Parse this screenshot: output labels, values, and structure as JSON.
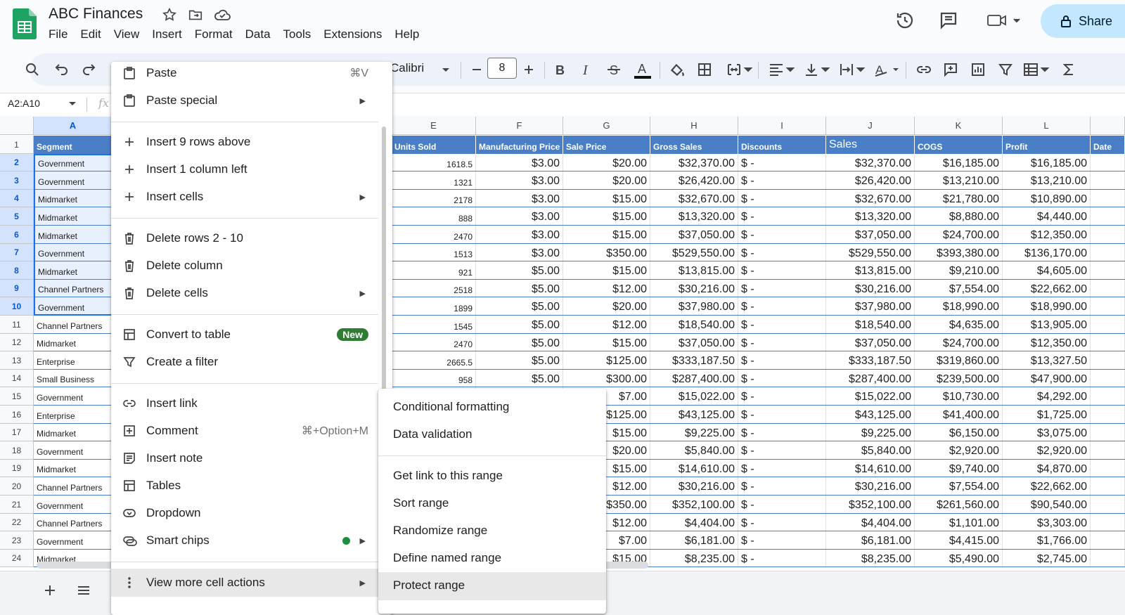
{
  "app": {
    "title": "ABC Finances",
    "share_label": "Share",
    "menu": [
      "File",
      "Edit",
      "View",
      "Insert",
      "Format",
      "Data",
      "Tools",
      "Extensions",
      "Help"
    ]
  },
  "toolbar": {
    "font": "Calibri",
    "font_size": "8"
  },
  "formula_bar": {
    "name_box": "A2:A10",
    "fx": "fx"
  },
  "grid": {
    "col_headers": [
      "A",
      "E",
      "F",
      "G",
      "H",
      "I",
      "J",
      "K",
      "L"
    ],
    "header_row": [
      "Segment",
      "Units Sold",
      "Manufacturing Price",
      "Sale Price",
      "Gross Sales",
      "Discounts",
      "Sales",
      "COGS",
      "Profit",
      "Date"
    ],
    "rows": [
      {
        "n": "1"
      },
      {
        "n": "2",
        "seg": "Government",
        "units": "1618.5",
        "mfg": "$3.00",
        "sale": "$20.00",
        "gross": "$32,370.00",
        "disc": "$ -",
        "sales": "$32,370.00",
        "cogs": "$16,185.00",
        "profit": "$16,185.00"
      },
      {
        "n": "3",
        "seg": "Government",
        "units": "1321",
        "mfg": "$3.00",
        "sale": "$20.00",
        "gross": "$26,420.00",
        "disc": "$ -",
        "sales": "$26,420.00",
        "cogs": "$13,210.00",
        "profit": "$13,210.00"
      },
      {
        "n": "4",
        "seg": "Midmarket",
        "units": "2178",
        "mfg": "$3.00",
        "sale": "$15.00",
        "gross": "$32,670.00",
        "disc": "$ -",
        "sales": "$32,670.00",
        "cogs": "$21,780.00",
        "profit": "$10,890.00"
      },
      {
        "n": "5",
        "seg": "Midmarket",
        "units": "888",
        "mfg": "$3.00",
        "sale": "$15.00",
        "gross": "$13,320.00",
        "disc": "$ -",
        "sales": "$13,320.00",
        "cogs": "$8,880.00",
        "profit": "$4,440.00"
      },
      {
        "n": "6",
        "seg": "Midmarket",
        "units": "2470",
        "mfg": "$3.00",
        "sale": "$15.00",
        "gross": "$37,050.00",
        "disc": "$ -",
        "sales": "$37,050.00",
        "cogs": "$24,700.00",
        "profit": "$12,350.00"
      },
      {
        "n": "7",
        "seg": "Government",
        "units": "1513",
        "mfg": "$3.00",
        "sale": "$350.00",
        "gross": "$529,550.00",
        "disc": "$ -",
        "sales": "$529,550.00",
        "cogs": "$393,380.00",
        "profit": "$136,170.00"
      },
      {
        "n": "8",
        "seg": "Midmarket",
        "units": "921",
        "mfg": "$5.00",
        "sale": "$15.00",
        "gross": "$13,815.00",
        "disc": "$ -",
        "sales": "$13,815.00",
        "cogs": "$9,210.00",
        "profit": "$4,605.00"
      },
      {
        "n": "9",
        "seg": "Channel Partners",
        "units": "2518",
        "mfg": "$5.00",
        "sale": "$12.00",
        "gross": "$30,216.00",
        "disc": "$ -",
        "sales": "$30,216.00",
        "cogs": "$7,554.00",
        "profit": "$22,662.00"
      },
      {
        "n": "10",
        "seg": "Government",
        "units": "1899",
        "mfg": "$5.00",
        "sale": "$20.00",
        "gross": "$37,980.00",
        "disc": "$ -",
        "sales": "$37,980.00",
        "cogs": "$18,990.00",
        "profit": "$18,990.00"
      },
      {
        "n": "11",
        "seg": "Channel Partners",
        "units": "1545",
        "mfg": "$5.00",
        "sale": "$12.00",
        "gross": "$18,540.00",
        "disc": "$ -",
        "sales": "$18,540.00",
        "cogs": "$4,635.00",
        "profit": "$13,905.00"
      },
      {
        "n": "12",
        "seg": "Midmarket",
        "units": "2470",
        "mfg": "$5.00",
        "sale": "$15.00",
        "gross": "$37,050.00",
        "disc": "$ -",
        "sales": "$37,050.00",
        "cogs": "$24,700.00",
        "profit": "$12,350.00"
      },
      {
        "n": "13",
        "seg": "Enterprise",
        "units": "2665.5",
        "mfg": "$5.00",
        "sale": "$125.00",
        "gross": "$333,187.50",
        "disc": "$ -",
        "sales": "$333,187.50",
        "cogs": "$319,860.00",
        "profit": "$13,327.50"
      },
      {
        "n": "14",
        "seg": "Small Business",
        "units": "958",
        "mfg": "$5.00",
        "sale": "$300.00",
        "gross": "$287,400.00",
        "disc": "$ -",
        "sales": "$287,400.00",
        "cogs": "$239,500.00",
        "profit": "$47,900.00"
      },
      {
        "n": "15",
        "seg": "Government",
        "sale": "$7.00",
        "gross": "$15,022.00",
        "disc": "$ -",
        "sales": "$15,022.00",
        "cogs": "$10,730.00",
        "profit": "$4,292.00"
      },
      {
        "n": "16",
        "seg": "Enterprise",
        "sale": "$125.00",
        "gross": "$43,125.00",
        "disc": "$ -",
        "sales": "$43,125.00",
        "cogs": "$41,400.00",
        "profit": "$1,725.00"
      },
      {
        "n": "17",
        "seg": "Midmarket",
        "sale": "$15.00",
        "gross": "$9,225.00",
        "disc": "$ -",
        "sales": "$9,225.00",
        "cogs": "$6,150.00",
        "profit": "$3,075.00"
      },
      {
        "n": "18",
        "seg": "Government",
        "sale": "$20.00",
        "gross": "$5,840.00",
        "disc": "$ -",
        "sales": "$5,840.00",
        "cogs": "$2,920.00",
        "profit": "$2,920.00"
      },
      {
        "n": "19",
        "seg": "Midmarket",
        "sale": "$15.00",
        "gross": "$14,610.00",
        "disc": "$ -",
        "sales": "$14,610.00",
        "cogs": "$9,740.00",
        "profit": "$4,870.00"
      },
      {
        "n": "20",
        "seg": "Channel Partners",
        "sale": "$12.00",
        "gross": "$30,216.00",
        "disc": "$ -",
        "sales": "$30,216.00",
        "cogs": "$7,554.00",
        "profit": "$22,662.00"
      },
      {
        "n": "21",
        "seg": "Government",
        "sale": "$350.00",
        "gross": "$352,100.00",
        "disc": "$ -",
        "sales": "$352,100.00",
        "cogs": "$261,560.00",
        "profit": "$90,540.00"
      },
      {
        "n": "22",
        "seg": "Channel Partners",
        "sale": "$12.00",
        "gross": "$4,404.00",
        "disc": "$ -",
        "sales": "$4,404.00",
        "cogs": "$1,101.00",
        "profit": "$3,303.00"
      },
      {
        "n": "23",
        "seg": "Government",
        "sale": "$7.00",
        "gross": "$6,181.00",
        "disc": "$ -",
        "sales": "$6,181.00",
        "cogs": "$4,415.00",
        "profit": "$1,766.00"
      },
      {
        "n": "24",
        "seg": "Midmarket",
        "sale": "$15.00",
        "gross": "$8,235.00",
        "disc": "$ -",
        "sales": "$8,235.00",
        "cogs": "$5,490.00",
        "profit": "$2,745.00"
      }
    ]
  },
  "context_menu": {
    "items": [
      {
        "label": "Paste",
        "shortcut": "⌘V",
        "icon": "clipboard-icon"
      },
      {
        "label": "Paste special",
        "icon": "clipboard-icon",
        "submenu": true
      },
      {
        "label": "Insert 9 rows above",
        "icon": "plus-icon"
      },
      {
        "label": "Insert 1 column left",
        "icon": "plus-icon"
      },
      {
        "label": "Insert cells",
        "icon": "plus-icon",
        "submenu": true
      },
      {
        "label": "Delete rows 2 - 10",
        "icon": "trash-icon"
      },
      {
        "label": "Delete column",
        "icon": "trash-icon"
      },
      {
        "label": "Delete cells",
        "icon": "trash-icon",
        "submenu": true
      },
      {
        "label": "Convert to table",
        "icon": "table-icon",
        "badge": "New"
      },
      {
        "label": "Create a filter",
        "icon": "filter-icon"
      },
      {
        "label": "Insert link",
        "icon": "link-icon"
      },
      {
        "label": "Comment",
        "shortcut": "⌘+Option+M",
        "icon": "comment-icon"
      },
      {
        "label": "Insert note",
        "icon": "note-icon"
      },
      {
        "label": "Tables",
        "icon": "table-icon"
      },
      {
        "label": "Dropdown",
        "icon": "dropdown-icon"
      },
      {
        "label": "Smart chips",
        "icon": "chips-icon",
        "submenu": true
      },
      {
        "label": "View more cell actions",
        "icon": "more-vert-icon",
        "submenu": true
      }
    ]
  },
  "submenu": {
    "items": [
      "Conditional formatting",
      "Data validation",
      "Get link to this range",
      "Sort range",
      "Randomize range",
      "Define named range",
      "Protect range"
    ]
  },
  "colors": {
    "header_blue": "#4a7fc8",
    "selection": "#d3e3fd",
    "share_bg": "#c2e7ff",
    "badge_green": "#2e7d32"
  }
}
